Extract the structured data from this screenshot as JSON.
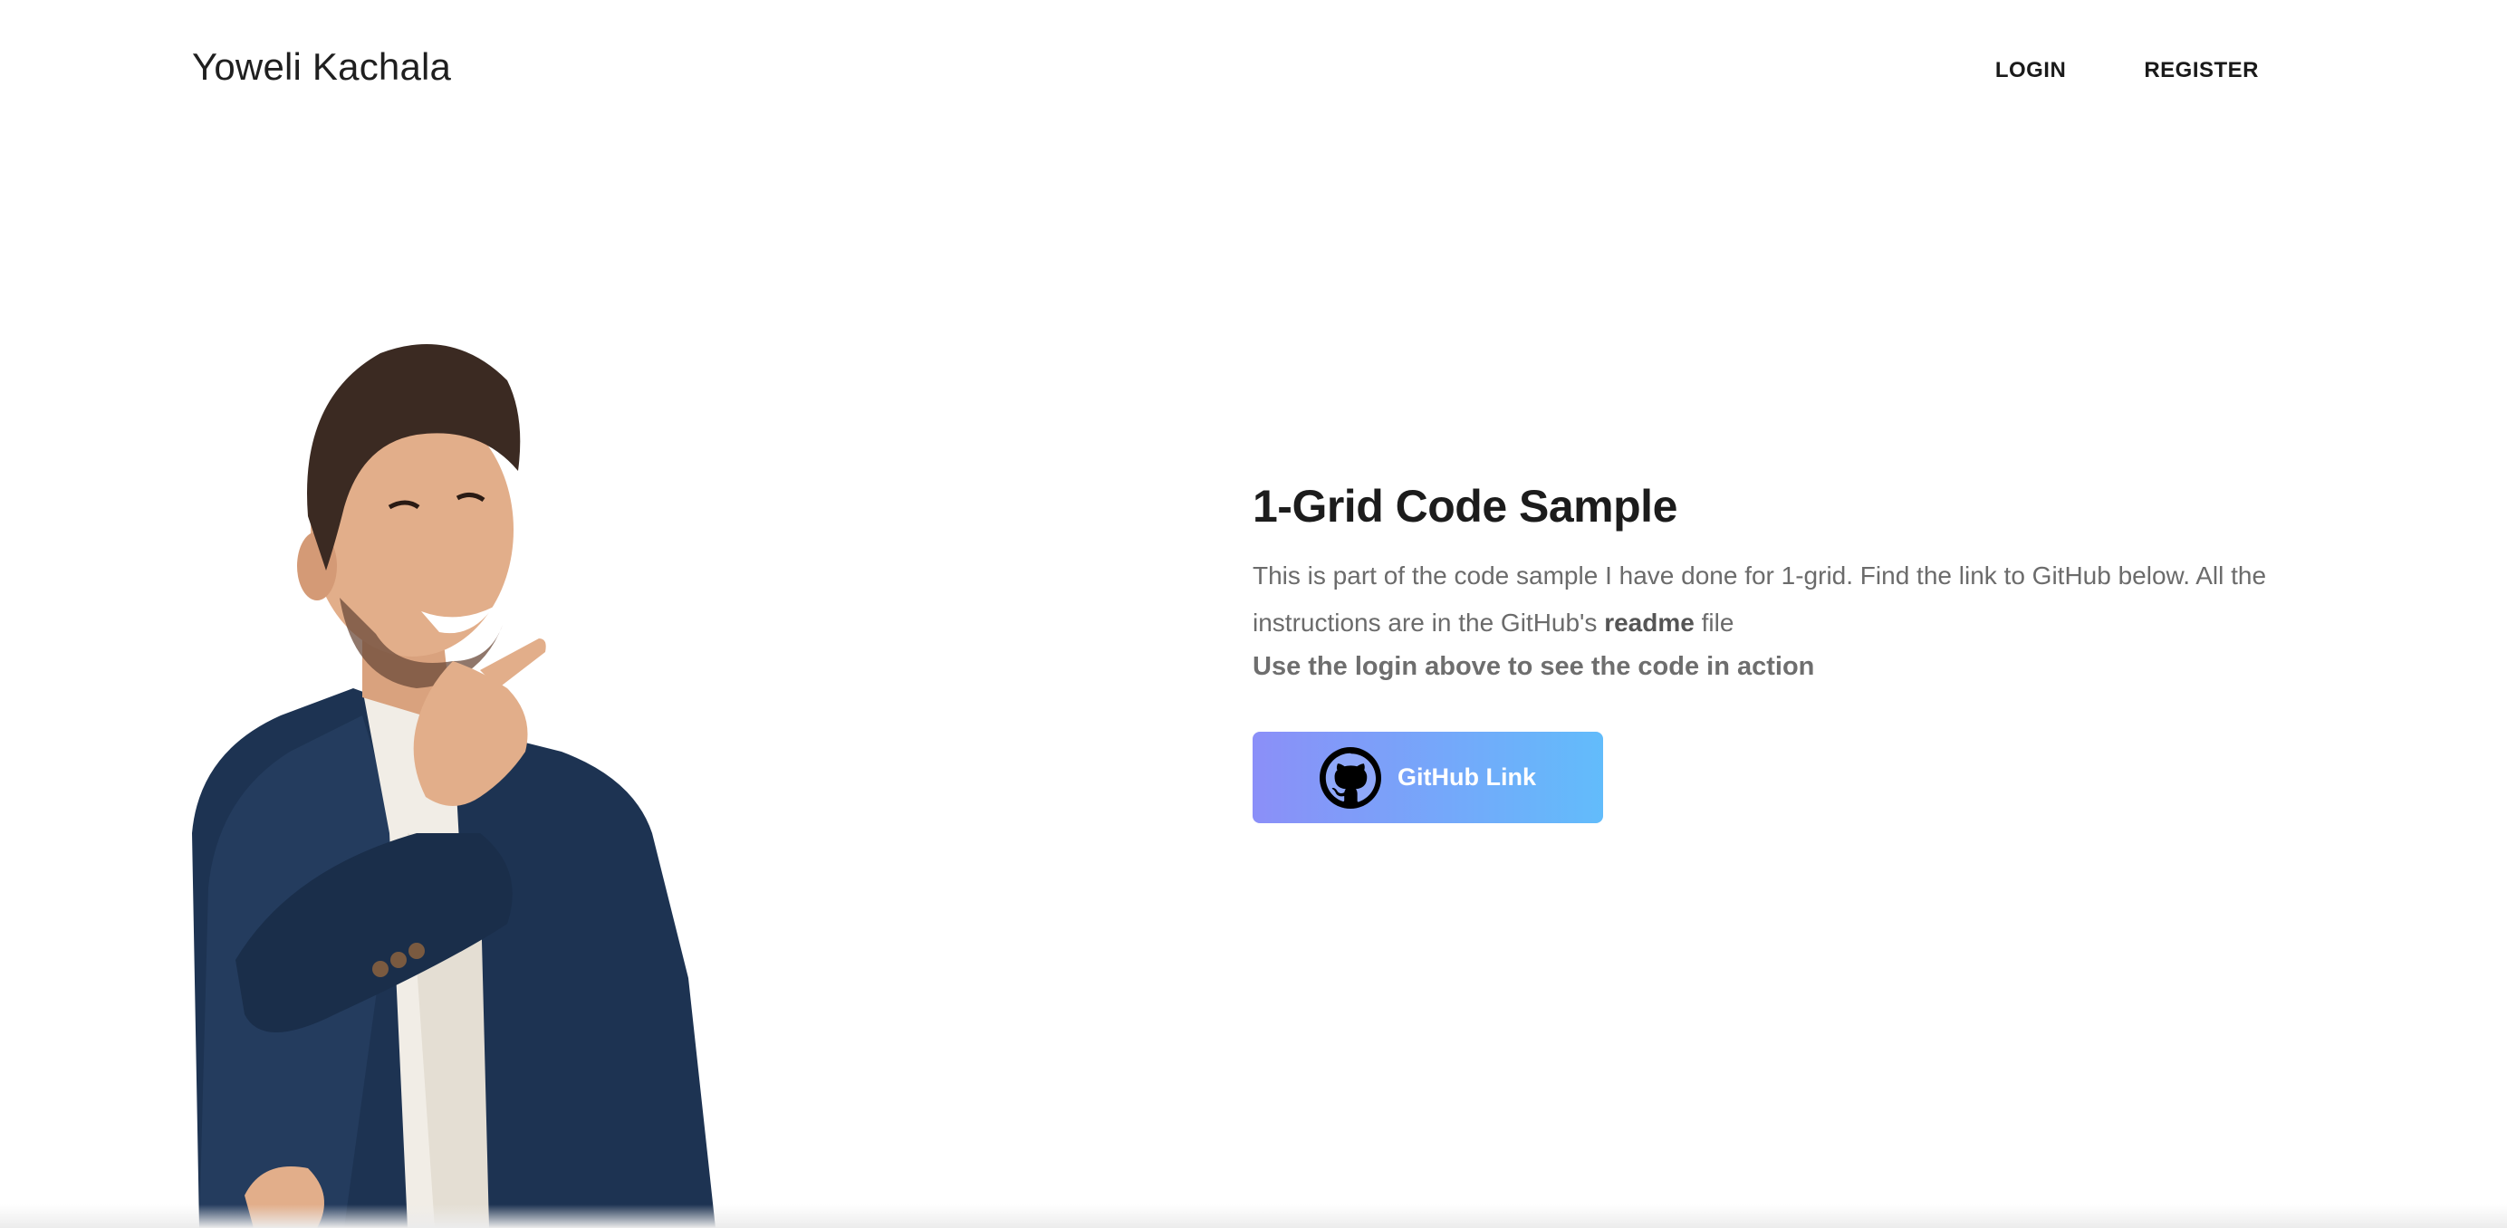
{
  "header": {
    "brand": "Yoweli Kachala",
    "nav": {
      "login_label": "LOGIN",
      "register_label": "REGISTER"
    }
  },
  "hero": {
    "image_icon": "thinking-man-photo"
  },
  "main": {
    "title": "1-Grid Code Sample",
    "description_part1": "This is part of the code sample I have done for 1-grid. Find the link to GitHub below. All the instructions are in the GitHub's ",
    "description_bold": "readme",
    "description_part2": " file",
    "cta_text": "Use the login above to see the code in action",
    "github_button": {
      "label": "GitHub Link",
      "icon": "github-icon"
    }
  },
  "colors": {
    "button_gradient_start": "#8b8ff8",
    "button_gradient_end": "#62bcfb",
    "title": "#1c1c1c",
    "body_text": "#6b6b6b"
  }
}
